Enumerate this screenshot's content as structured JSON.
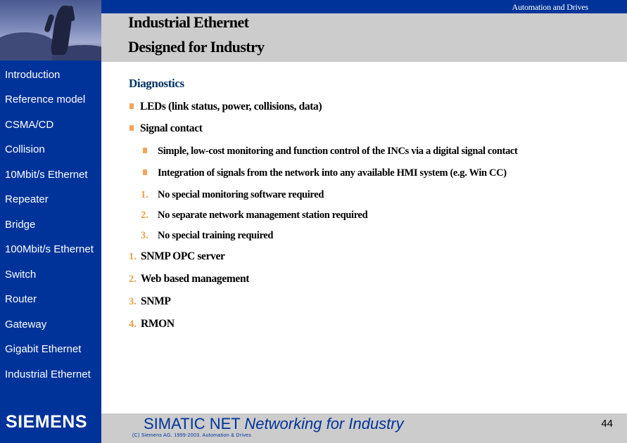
{
  "header": {
    "brand_text": "Automation and Drives",
    "title_line1": "Industrial Ethernet",
    "title_line2": "Designed for Industry"
  },
  "sidebar": {
    "items": [
      {
        "label": "Introduction"
      },
      {
        "label": "Reference model"
      },
      {
        "label": "CSMA/CD"
      },
      {
        "label": "Collision"
      },
      {
        "label": "10Mbit/s Ethernet"
      },
      {
        "label": "Repeater"
      },
      {
        "label": "Bridge"
      },
      {
        "label": "100Mbit/s Ethernet"
      },
      {
        "label": "Switch"
      },
      {
        "label": "Router"
      },
      {
        "label": "Gateway"
      },
      {
        "label": "Gigabit Ethernet"
      },
      {
        "label": "Industrial Ethernet"
      }
    ]
  },
  "content": {
    "heading": "Diagnostics",
    "bullets": [
      "LEDs (link status, power, collisions, data)",
      "Signal contact"
    ],
    "sub_bullets": [
      "Simple, low-cost monitoring and function control of the INCs via a digital signal contact",
      "Integration of signals from the network into any available HMI system (e.g. Win CC)"
    ],
    "sub_numbered": [
      {
        "num": "1.",
        "text": "No special monitoring software required"
      },
      {
        "num": "2.",
        "text": "No separate network management station required"
      },
      {
        "num": "3.",
        "text": "No special training required"
      }
    ],
    "numbered": [
      {
        "num": "1.",
        "text": "SNMP OPC server"
      },
      {
        "num": "2.",
        "text": "Web based management"
      },
      {
        "num": "3.",
        "text": "SNMP"
      },
      {
        "num": "4.",
        "text": "RMON"
      }
    ]
  },
  "footer": {
    "logo": "SIEMENS",
    "title_regular": "SIMATIC NET ",
    "title_italic": "Networking for Industry",
    "copyright": "(C) Siemens AG. 1999-2003. Automation & Drives",
    "page_number": "44"
  },
  "colors": {
    "brand_blue": "#003399",
    "band_grey": "#cccccc",
    "accent_orange": "#e8a24a"
  }
}
